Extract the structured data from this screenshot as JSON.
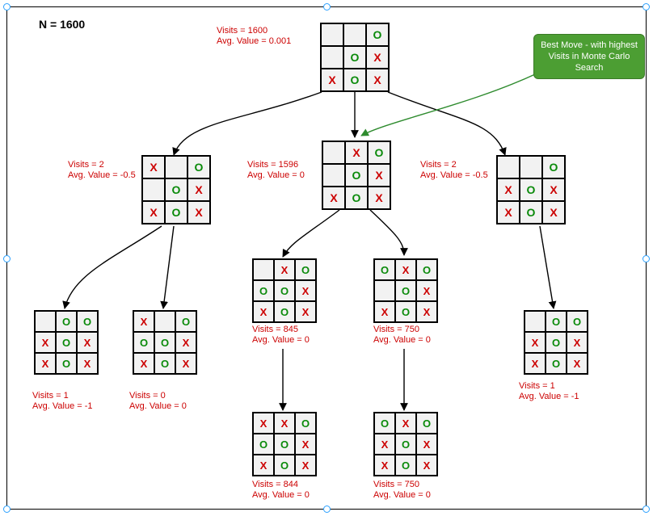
{
  "title": "N = 1600",
  "callout": "Best Move - with highest Visits in Monte Carlo Search",
  "nodes": {
    "root": {
      "visits": 1600,
      "avg": "0.001",
      "grid": [
        "",
        "",
        "O",
        "",
        "O",
        "X",
        "X",
        "O",
        "X"
      ]
    },
    "l1a": {
      "visits": 2,
      "avg": "-0.5",
      "grid": [
        "X",
        "",
        "O",
        "",
        "O",
        "X",
        "X",
        "O",
        "X"
      ]
    },
    "l1b": {
      "visits": 1596,
      "avg": "0",
      "grid": [
        "",
        "X",
        "O",
        "",
        "O",
        "X",
        "X",
        "O",
        "X"
      ]
    },
    "l1c": {
      "visits": 2,
      "avg": "-0.5",
      "grid": [
        "",
        "",
        "O",
        "X",
        "O",
        "X",
        "X",
        "O",
        "X"
      ]
    },
    "l2a": {
      "visits": 1,
      "avg": "-1",
      "grid": [
        "",
        "O",
        "O",
        "X",
        "O",
        "X",
        "X",
        "O",
        "X"
      ]
    },
    "l2b": {
      "visits": 0,
      "avg": "0",
      "grid": [
        "X",
        "",
        "O",
        "O",
        "O",
        "X",
        "X",
        "O",
        "X"
      ]
    },
    "l2c": {
      "visits": 845,
      "avg": "0",
      "grid": [
        "",
        "X",
        "O",
        "O",
        "O",
        "X",
        "X",
        "O",
        "X"
      ]
    },
    "l2d": {
      "visits": 750,
      "avg": "0",
      "grid": [
        "O",
        "X",
        "O",
        "",
        "O",
        "X",
        "X",
        "O",
        "X"
      ]
    },
    "l2e": {
      "visits": 1,
      "avg": "-1",
      "grid": [
        "",
        "O",
        "O",
        "X",
        "O",
        "X",
        "X",
        "O",
        "X"
      ]
    },
    "l3c": {
      "visits": 844,
      "avg": "0",
      "grid": [
        "X",
        "X",
        "O",
        "O",
        "O",
        "X",
        "X",
        "O",
        "X"
      ]
    },
    "l3d": {
      "visits": 750,
      "avg": "0",
      "grid": [
        "O",
        "X",
        "O",
        "X",
        "O",
        "X",
        "X",
        "O",
        "X"
      ]
    }
  }
}
